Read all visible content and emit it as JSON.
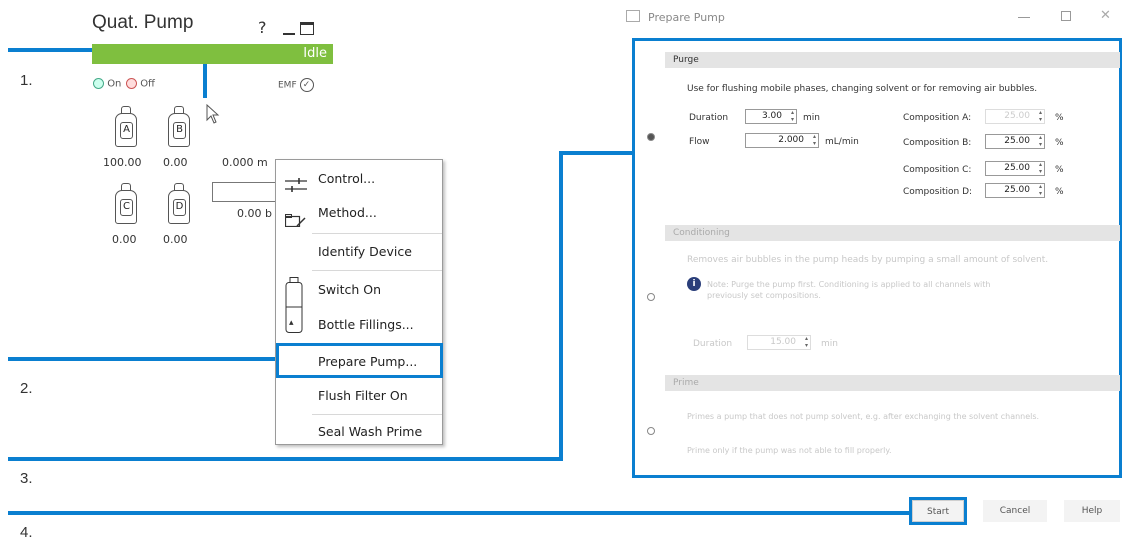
{
  "steps": [
    "1.",
    "2.",
    "3.",
    "4."
  ],
  "pump": {
    "title": "Quat. Pump",
    "help_glyph": "?",
    "minimize_glyph": "_",
    "status": "Idle",
    "on_label": "On",
    "off_label": "Off",
    "emf_label": "EMF",
    "bottles": [
      {
        "letter": "A",
        "value": "100.00"
      },
      {
        "letter": "B",
        "value": "0.00"
      },
      {
        "letter": "C",
        "value": "0.00"
      },
      {
        "letter": "D",
        "value": "0.00"
      }
    ],
    "flow_text": "0.000 m",
    "pressure_text": "0.00 b"
  },
  "menu": {
    "items": [
      "Control...",
      "Method...",
      "Identify Device",
      "Switch On",
      "Bottle Fillings...",
      "Prepare Pump...",
      "Flush Filter On",
      "Seal Wash Prime"
    ]
  },
  "dialog": {
    "title": "Prepare Pump",
    "purge": {
      "header": "Purge",
      "description": "Use for flushing mobile phases, changing solvent or for removing air bubbles.",
      "duration_label": "Duration",
      "duration_value": "3.00",
      "duration_unit": "min",
      "flow_label": "Flow",
      "flow_value": "2.000",
      "flow_unit": "mL/min",
      "compositions": [
        {
          "label": "Composition A:",
          "value": "25.00",
          "unit": "%"
        },
        {
          "label": "Composition B:",
          "value": "25.00",
          "unit": "%"
        },
        {
          "label": "Composition C:",
          "value": "25.00",
          "unit": "%"
        },
        {
          "label": "Composition D:",
          "value": "25.00",
          "unit": "%"
        }
      ]
    },
    "conditioning": {
      "header": "Conditioning",
      "description": "Removes air bubbles in the pump heads by pumping a small amount of solvent.",
      "info": "Note: Purge the pump first. Conditioning is applied to all channels with previously set compositions.",
      "duration_label": "Duration",
      "duration_value": "15.00",
      "duration_unit": "min"
    },
    "prime": {
      "header": "Prime",
      "description": "Primes a pump that does not pump solvent, e.g. after exchanging the solvent channels.",
      "note": "Prime only if the pump was not able to fill properly."
    },
    "buttons": {
      "start": "Start",
      "cancel": "Cancel",
      "help": "Help"
    }
  }
}
